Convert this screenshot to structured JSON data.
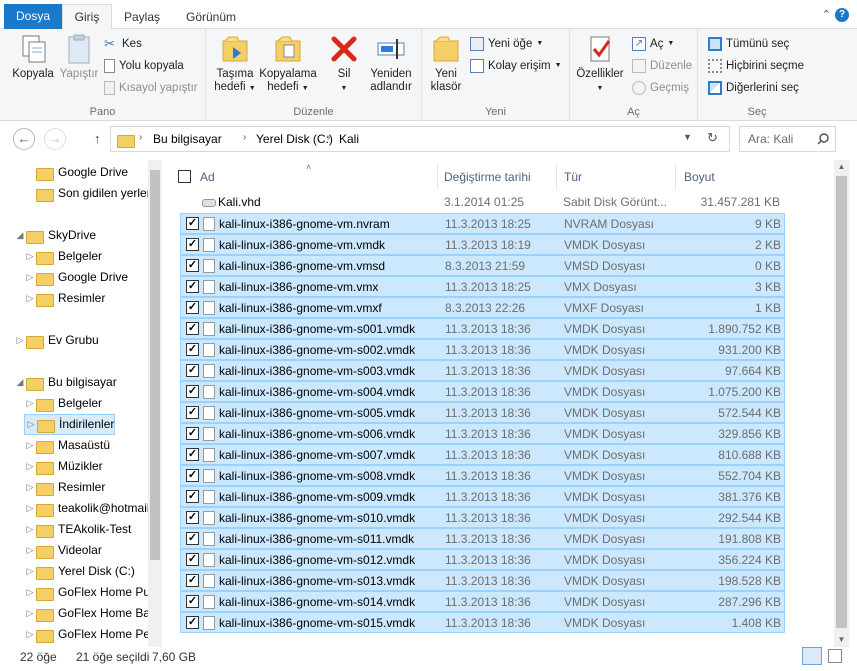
{
  "tabs": {
    "file": "Dosya",
    "home": "Giriş",
    "share": "Paylaş",
    "view": "Görünüm"
  },
  "ribbon": {
    "pano": {
      "label": "Pano",
      "copy": "Kopyala",
      "paste": "Yapıştır",
      "cut": "Kes",
      "copy_path": "Yolu kopyala",
      "paste_shortcut": "Kısayol yapıştır"
    },
    "duzenle": {
      "label": "Düzenle",
      "move_l1": "Taşıma",
      "move_l2": "hedefi",
      "copy_l1": "Kopyalama",
      "copy_l2": "hedefi",
      "delete": "Sil",
      "rename_l1": "Yeniden",
      "rename_l2": "adlandır"
    },
    "yeni": {
      "label": "Yeni",
      "folder_l1": "Yeni",
      "folder_l2": "klasör",
      "new_item": "Yeni öğe",
      "easy_access": "Kolay erişim"
    },
    "ac": {
      "label": "Aç",
      "properties": "Özellikler",
      "open": "Aç",
      "edit": "Düzenle",
      "history": "Geçmiş"
    },
    "sec": {
      "label": "Seç",
      "select_all": "Tümünü seç",
      "select_none": "Hiçbirini seçme",
      "invert": "Diğerlerini seç"
    }
  },
  "address": {
    "pc": "Bu bilgisayar",
    "drive": "Yerel Disk (C:)",
    "folder": "Kali",
    "search_placeholder": "Ara: Kali"
  },
  "sidebar": [
    {
      "label": "Google Drive",
      "icon": "folder-icon",
      "indent": 1
    },
    {
      "label": "Son gidilen yerler",
      "icon": "folder-icon",
      "indent": 1
    },
    {
      "label": "SkyDrive",
      "icon": "cloud-icon",
      "indent": 0
    },
    {
      "label": "Belgeler",
      "icon": "folder-icon",
      "indent": 1
    },
    {
      "label": "Google Drive",
      "icon": "folder-icon",
      "indent": 1
    },
    {
      "label": "Resimler",
      "icon": "folder-icon",
      "indent": 1
    },
    {
      "label": "Ev Grubu",
      "icon": "homegroup-icon",
      "indent": 0
    },
    {
      "label": "Bu bilgisayar",
      "icon": "computer-icon",
      "indent": 0
    },
    {
      "label": "Belgeler",
      "icon": "folder-icon",
      "indent": 1
    },
    {
      "label": "İndirilenler",
      "icon": "folder-icon",
      "indent": 1
    },
    {
      "label": "Masaüstü",
      "icon": "folder-icon",
      "indent": 1
    },
    {
      "label": "Müzikler",
      "icon": "folder-icon",
      "indent": 1
    },
    {
      "label": "Resimler",
      "icon": "folder-icon",
      "indent": 1
    },
    {
      "label": "teakolik@hotmail",
      "icon": "network-icon",
      "indent": 1
    },
    {
      "label": "TEAkolik-Test",
      "icon": "network-icon",
      "indent": 1
    },
    {
      "label": "Videolar",
      "icon": "folder-icon",
      "indent": 1
    },
    {
      "label": "Yerel Disk (C:)",
      "icon": "drive-icon",
      "indent": 1
    },
    {
      "label": "GoFlex Home Pu",
      "icon": "drive-icon",
      "indent": 1
    },
    {
      "label": "GoFlex Home Ba",
      "icon": "drive-icon",
      "indent": 1
    },
    {
      "label": "GoFlex Home Pe",
      "icon": "drive-icon",
      "indent": 1
    }
  ],
  "columns": {
    "name": "Ad",
    "date": "Değiştirme tarihi",
    "type": "Tür",
    "size": "Boyut"
  },
  "files": [
    {
      "name": "Kali.vhd",
      "date": "3.1.2014 01:25",
      "type": "Sabit Disk Görünt...",
      "size": "31.457.281 KB",
      "selected": false
    },
    {
      "name": "kali-linux-i386-gnome-vm.nvram",
      "date": "11.3.2013 18:25",
      "type": "NVRAM Dosyası",
      "size": "9 KB",
      "selected": true
    },
    {
      "name": "kali-linux-i386-gnome-vm.vmdk",
      "date": "11.3.2013 18:19",
      "type": "VMDK Dosyası",
      "size": "2 KB",
      "selected": true
    },
    {
      "name": "kali-linux-i386-gnome-vm.vmsd",
      "date": "8.3.2013 21:59",
      "type": "VMSD Dosyası",
      "size": "0 KB",
      "selected": true
    },
    {
      "name": "kali-linux-i386-gnome-vm.vmx",
      "date": "11.3.2013 18:25",
      "type": "VMX Dosyası",
      "size": "3 KB",
      "selected": true
    },
    {
      "name": "kali-linux-i386-gnome-vm.vmxf",
      "date": "8.3.2013 22:26",
      "type": "VMXF Dosyası",
      "size": "1 KB",
      "selected": true
    },
    {
      "name": "kali-linux-i386-gnome-vm-s001.vmdk",
      "date": "11.3.2013 18:36",
      "type": "VMDK Dosyası",
      "size": "1.890.752 KB",
      "selected": true
    },
    {
      "name": "kali-linux-i386-gnome-vm-s002.vmdk",
      "date": "11.3.2013 18:36",
      "type": "VMDK Dosyası",
      "size": "931.200 KB",
      "selected": true
    },
    {
      "name": "kali-linux-i386-gnome-vm-s003.vmdk",
      "date": "11.3.2013 18:36",
      "type": "VMDK Dosyası",
      "size": "97.664 KB",
      "selected": true
    },
    {
      "name": "kali-linux-i386-gnome-vm-s004.vmdk",
      "date": "11.3.2013 18:36",
      "type": "VMDK Dosyası",
      "size": "1.075.200 KB",
      "selected": true
    },
    {
      "name": "kali-linux-i386-gnome-vm-s005.vmdk",
      "date": "11.3.2013 18:36",
      "type": "VMDK Dosyası",
      "size": "572.544 KB",
      "selected": true
    },
    {
      "name": "kali-linux-i386-gnome-vm-s006.vmdk",
      "date": "11.3.2013 18:36",
      "type": "VMDK Dosyası",
      "size": "329.856 KB",
      "selected": true
    },
    {
      "name": "kali-linux-i386-gnome-vm-s007.vmdk",
      "date": "11.3.2013 18:36",
      "type": "VMDK Dosyası",
      "size": "810.688 KB",
      "selected": true
    },
    {
      "name": "kali-linux-i386-gnome-vm-s008.vmdk",
      "date": "11.3.2013 18:36",
      "type": "VMDK Dosyası",
      "size": "552.704 KB",
      "selected": true
    },
    {
      "name": "kali-linux-i386-gnome-vm-s009.vmdk",
      "date": "11.3.2013 18:36",
      "type": "VMDK Dosyası",
      "size": "381.376 KB",
      "selected": true
    },
    {
      "name": "kali-linux-i386-gnome-vm-s010.vmdk",
      "date": "11.3.2013 18:36",
      "type": "VMDK Dosyası",
      "size": "292.544 KB",
      "selected": true
    },
    {
      "name": "kali-linux-i386-gnome-vm-s011.vmdk",
      "date": "11.3.2013 18:36",
      "type": "VMDK Dosyası",
      "size": "191.808 KB",
      "selected": true
    },
    {
      "name": "kali-linux-i386-gnome-vm-s012.vmdk",
      "date": "11.3.2013 18:36",
      "type": "VMDK Dosyası",
      "size": "356.224 KB",
      "selected": true
    },
    {
      "name": "kali-linux-i386-gnome-vm-s013.vmdk",
      "date": "11.3.2013 18:36",
      "type": "VMDK Dosyası",
      "size": "198.528 KB",
      "selected": true
    },
    {
      "name": "kali-linux-i386-gnome-vm-s014.vmdk",
      "date": "11.3.2013 18:36",
      "type": "VMDK Dosyası",
      "size": "287.296 KB",
      "selected": true
    },
    {
      "name": "kali-linux-i386-gnome-vm-s015.vmdk",
      "date": "11.3.2013 18:36",
      "type": "VMDK Dosyası",
      "size": "1.408 KB",
      "selected": true
    }
  ],
  "status": {
    "count": "22 öğe",
    "selected": "21 öğe seçildi",
    "size": "7,60 GB"
  },
  "colors": {
    "accent": "#1979ca",
    "selection": "#cce8ff",
    "selection_border": "#99d1ff"
  }
}
